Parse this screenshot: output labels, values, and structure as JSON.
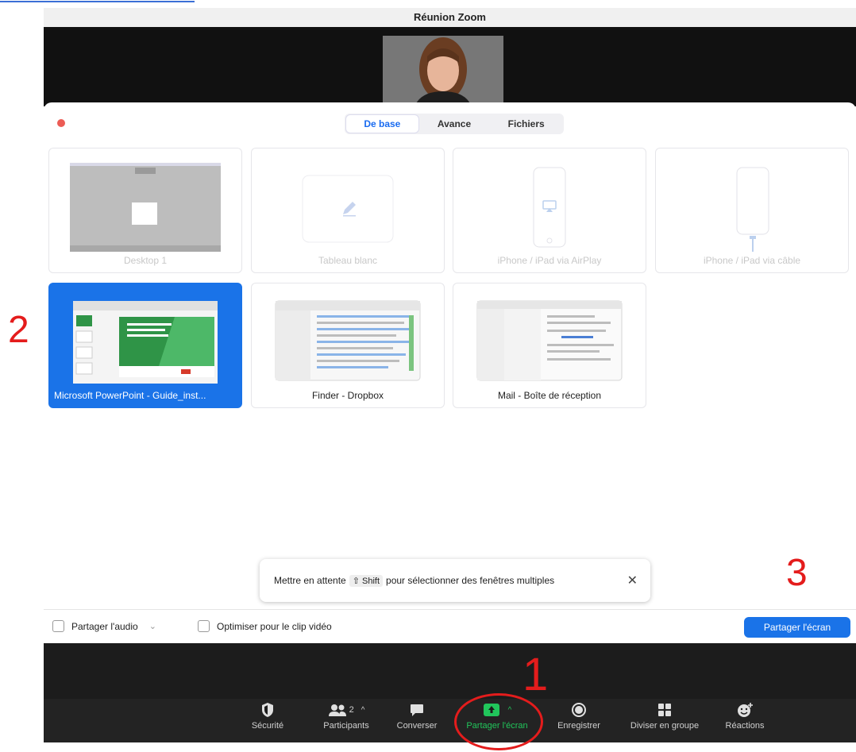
{
  "window": {
    "title": "Réunion Zoom"
  },
  "tabs": [
    {
      "label": "De base",
      "active": true
    },
    {
      "label": "Avance",
      "active": false
    },
    {
      "label": "Fichiers",
      "active": false
    }
  ],
  "tiles": [
    {
      "label": "Desktop 1"
    },
    {
      "label": "Tableau blanc"
    },
    {
      "label": "iPhone / iPad via AirPlay"
    },
    {
      "label": "iPhone / iPad via câble"
    },
    {
      "label": "Microsoft PowerPoint - Guide_inst..."
    },
    {
      "label": "Finder - Dropbox"
    },
    {
      "label": "Mail - Boîte de réception"
    }
  ],
  "hint": {
    "before": "Mettre en attente",
    "key": "⇧ Shift",
    "after": "pour sélectionner des fenêtres multiples",
    "close": "✕"
  },
  "options": {
    "audio": "Partager l'audio",
    "audio_chevron": "⌄",
    "video": "Optimiser pour le clip vidéo"
  },
  "share_button": "Partager l'écran",
  "toolbar": {
    "security": "Sécurité",
    "participants": "Participants",
    "participants_count": "2",
    "chat": "Converser",
    "share": "Partager l'écran",
    "record": "Enregistrer",
    "breakout": "Diviser en groupe",
    "reactions": "Réactions"
  },
  "annotations": [
    "1",
    "2",
    "3"
  ],
  "colors": {
    "accent": "#1a73e8",
    "share_green": "#21c65b",
    "annotation_red": "#e41c1c"
  }
}
